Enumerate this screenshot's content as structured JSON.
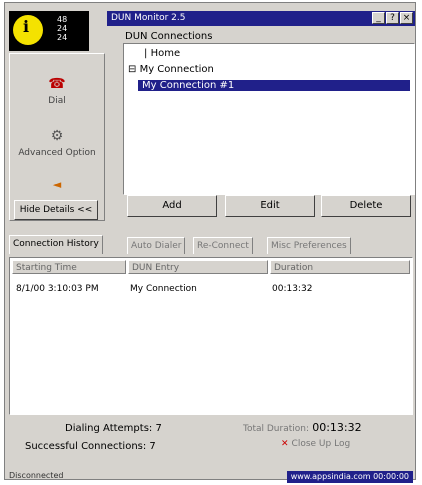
{
  "window": {
    "title": "DUN Monitor 2.5",
    "buttons": [
      "_",
      "?",
      "×"
    ]
  },
  "logo": {
    "mark": "i",
    "dots": [
      "48",
      "24",
      "24"
    ]
  },
  "connections": {
    "label": "DUN Connections",
    "root": "Home",
    "group": "My Connection",
    "selected": "My Connection #1"
  },
  "left_buttons": {
    "dial": "Dial",
    "advanced": "Advanced Option",
    "hide": "Hide Details <<"
  },
  "actions": {
    "add": "Add",
    "edit": "Edit",
    "delete": "Delete"
  },
  "tabs": [
    "Connection History",
    "Auto Dialer",
    "Re-Connect",
    "Misc Preferences"
  ],
  "history": {
    "columns": [
      "Starting Time",
      "DUN Entry",
      "Duration"
    ],
    "rows": [
      {
        "time": "8/1/00 3:10:03 PM",
        "entry": "My Connection",
        "duration": "00:13:32"
      }
    ]
  },
  "stats": {
    "dialing_attempts_label": "Dialing Attempts:",
    "dialing_attempts": "7",
    "successful_label": "Successful Connections:",
    "successful": "7",
    "total_label": "Total Duration:",
    "total": "00:13:32",
    "close_label": "Close Up Log"
  },
  "status": {
    "ready": "Disconnected",
    "url": "www.appsindia.com",
    "clock": "00:00:00"
  }
}
